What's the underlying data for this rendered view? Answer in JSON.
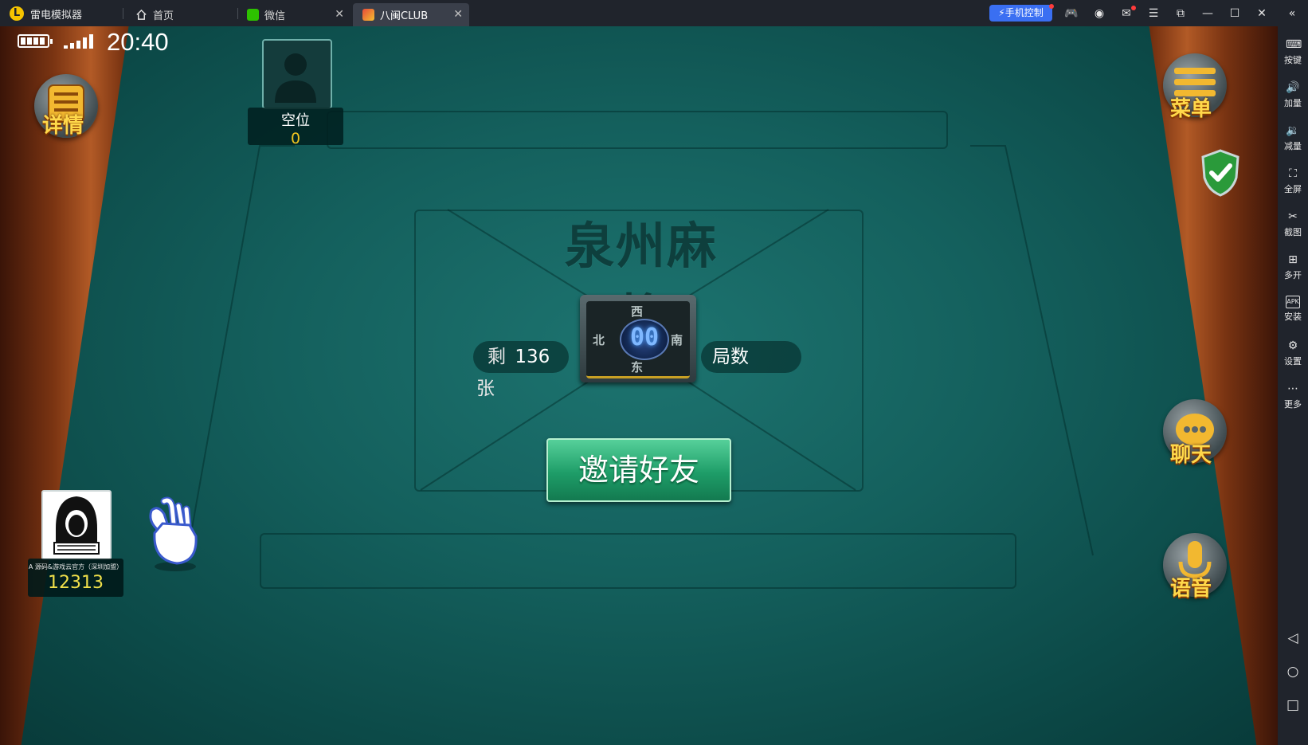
{
  "titlebar": {
    "app_title": "雷电模拟器",
    "tabs": [
      {
        "label": "首页",
        "icon": "home-icon"
      },
      {
        "label": "微信",
        "icon": "wechat-icon"
      },
      {
        "label": "八闽CLUB",
        "icon": "game-icon",
        "active": true
      }
    ],
    "phone_control": "手机控制",
    "accent": "#3a6ff2"
  },
  "sidebar": {
    "items": [
      {
        "label": "按键",
        "icon": "keyboard-icon"
      },
      {
        "label": "加量",
        "icon": "volume-up-icon"
      },
      {
        "label": "减量",
        "icon": "volume-down-icon"
      },
      {
        "label": "全屏",
        "icon": "fullscreen-icon"
      },
      {
        "label": "截图",
        "icon": "scissors-icon"
      },
      {
        "label": "多开",
        "icon": "multi-instance-icon"
      },
      {
        "label": "安装",
        "icon": "apk-icon"
      },
      {
        "label": "设置",
        "icon": "gear-icon"
      },
      {
        "label": "更多",
        "icon": "more-icon"
      }
    ]
  },
  "status": {
    "time": "20:40"
  },
  "game": {
    "details_label": "详情",
    "menu_label": "菜单",
    "chat_label": "聊天",
    "voice_label": "语音",
    "table_title": "泉州麻将",
    "empty_seat": {
      "name": "空位",
      "score": "0"
    },
    "player": {
      "name": "A 源码&游戏云官方（深圳加盟）",
      "score": "12313"
    },
    "remaining": {
      "prefix": "剩",
      "count": "136",
      "suffix": "张"
    },
    "rounds_label": "局数",
    "dial_value": "00",
    "directions": {
      "west": "西",
      "south": "南",
      "east": "东",
      "north": "北"
    },
    "invite_label": "邀请好友",
    "colors": {
      "felt": "#14605d",
      "invite": "#1e9d68",
      "label_gold": "#ffd84a"
    }
  }
}
